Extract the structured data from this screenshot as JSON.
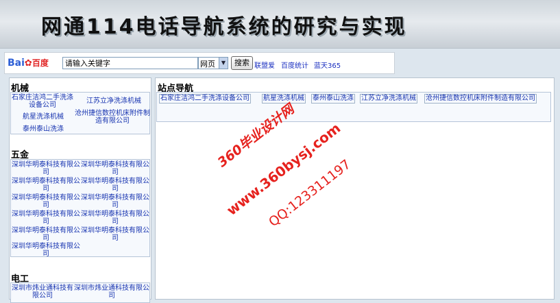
{
  "banner": {
    "title": "网通114电话导航系统的研究与实现"
  },
  "search": {
    "logo_text": "Bai",
    "logo_paw": "✿",
    "logo_cn": "百度",
    "input_value": "请输入关键字",
    "select_value": "网页",
    "button_label": "搜索",
    "links": [
      "联盟爱",
      "百度统计",
      "蓝天365"
    ]
  },
  "left": {
    "sections": [
      {
        "title": "机械",
        "items": [
          "石家庄洁鸿二手洗涤设备公司",
          "江苏立净洗涤机械",
          "航星洗涤机械",
          "沧州捷信数控机床附件制造有限公司",
          "泰州泰山洗涤"
        ]
      },
      {
        "title": "五金",
        "items": [
          "深圳华明泰科技有限公司",
          "深圳华明泰科技有限公司",
          "深圳华明泰科技有限公司",
          "深圳华明泰科技有限公司",
          "深圳华明泰科技有限公司",
          "深圳华明泰科技有限公司",
          "深圳华明泰科技有限公司",
          "深圳华明泰科技有限公司",
          "深圳华明泰科技有限公司",
          "深圳华明泰科技有限公司",
          "深圳华明泰科技有限公司"
        ]
      },
      {
        "title": "电工",
        "items": [
          "深圳市炜业通科技有限公司",
          "深圳市炜业通科技有限公司"
        ]
      }
    ]
  },
  "right": {
    "title": "站点导航",
    "links": [
      "石家庄洁鸿二手洗涤设备公司",
      "航星洗涤机械",
      "泰州泰山洗涤",
      "江苏立净洗涤机械",
      "沧州捷信数控机床附件制造有限公司"
    ]
  },
  "watermark": {
    "line1": "360毕业设计网",
    "line2": "www.360bysj.com",
    "line3": "QQ:123311197",
    "color": "#e6221e"
  }
}
